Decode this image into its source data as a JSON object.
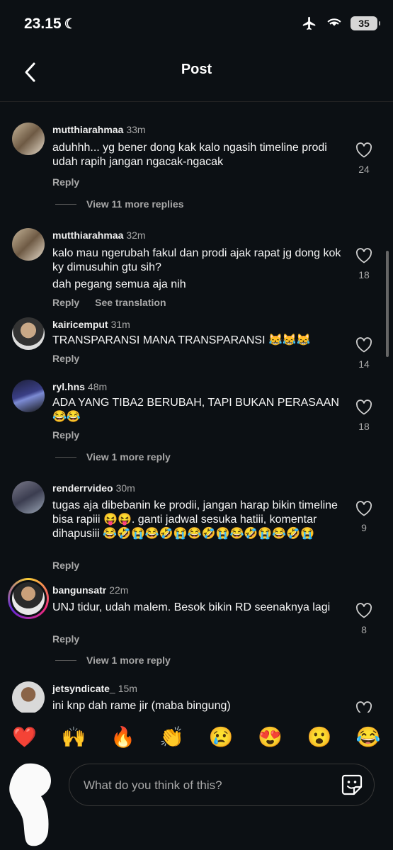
{
  "status": {
    "time": "23.15",
    "battery": "35"
  },
  "header": {
    "title": "Post"
  },
  "comments": [
    {
      "username": "mutthiarahmaa",
      "time": "33m",
      "text": "aduhhh... yg bener dong kak kalo ngasih timeline prodi udah rapih jangan ngacak-ngacak",
      "likes": "24",
      "reply": "Reply",
      "view_more": "View 11 more replies"
    },
    {
      "username": "mutthiarahmaa",
      "time": "32m",
      "text": "kalo mau ngerubah fakul dan prodi ajak rapat jg dong kok ky dimusuhin gtu sih?",
      "text2": "dah pegang semua aja nih",
      "likes": "18",
      "reply": "Reply",
      "translation": "See translation"
    },
    {
      "username": "kairicemput",
      "time": "31m",
      "text": "TRANSPARANSI MANA TRANSPARANSI 😹😹😹",
      "likes": "14",
      "reply": "Reply"
    },
    {
      "username": "ryl.hns",
      "time": "48m",
      "text": "ADA YANG TIBA2 BERUBAH, TAPI BUKAN PERASAAN 😂😂",
      "likes": "18",
      "reply": "Reply",
      "view_more": "View 1 more reply"
    },
    {
      "username": "renderrvideo",
      "time": "30m",
      "text": "tugas aja dibebanin ke prodii, jangan harap bikin timeline bisa rapiii 😝😝. ganti jadwal sesuka hatiii, komentar dihapusiii 😂🤣😭😂🤣😭😂🤣😭😂🤣😭😂🤣😭",
      "likes": "9",
      "reply": "Reply"
    },
    {
      "username": "bangunsatr",
      "time": "22m",
      "text": "UNJ tidur, udah malem. Besok bikin RD seenaknya lagi",
      "likes": "8",
      "reply": "Reply",
      "view_more": "View 1 more reply"
    },
    {
      "username": "jetsyndicate_",
      "time": "15m",
      "text": "ini knp dah rame jir (maba bingung)"
    }
  ],
  "reactions": [
    "❤️",
    "🙌",
    "🔥",
    "👏",
    "😢",
    "😍",
    "😮",
    "😂"
  ],
  "composer": {
    "placeholder": "What do you think of this?"
  },
  "colors": {
    "background": "#0c1014",
    "muted": "#a8a8a8",
    "heart": "#e0245e"
  }
}
